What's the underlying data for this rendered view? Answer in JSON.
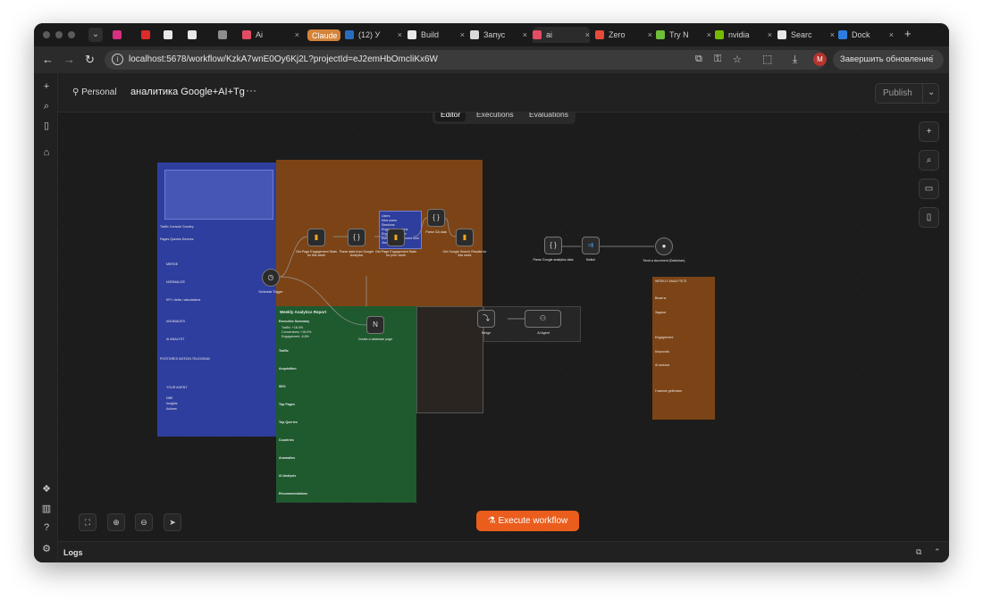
{
  "browser": {
    "tabs": [
      {
        "label": "",
        "color": "#d6307f"
      },
      {
        "label": "",
        "color": "#e12b2b"
      },
      {
        "label": "",
        "color": "#e8e8e8"
      },
      {
        "label": "",
        "color": "#e8e8e8"
      },
      {
        "label": "",
        "color": "#8d8d8d"
      },
      {
        "label": "Ai",
        "color": "#e24d64"
      },
      {
        "label": "Claude",
        "color": "#d4833a"
      },
      {
        "label": "(12) У",
        "color": "#2a6dc0"
      },
      {
        "label": "Build",
        "color": "#e8e8e8"
      },
      {
        "label": "Запус",
        "color": "#d9d9d9"
      },
      {
        "label": "ai",
        "color": "#e24d64"
      },
      {
        "label": "Zero",
        "color": "#e84a3a"
      },
      {
        "label": "Try N",
        "color": "#6fbf3a"
      },
      {
        "label": "nvidia",
        "color": "#76b900"
      },
      {
        "label": "Searc",
        "color": "#e8e8e8"
      },
      {
        "label": "Dock",
        "color": "#2b7ee0"
      }
    ],
    "url": "localhost:5678/workflow/KzkA7wnE0Oy6Kj2L?projectId=eJ2emHbOmcliKx6W",
    "avatar_letter": "M",
    "update_label": "Завершить обновление"
  },
  "header": {
    "project": "Personal",
    "title": "аналитика Google+AI+Tg",
    "publish_label": "Publish"
  },
  "modes": [
    "Editor",
    "Executions",
    "Evaluations"
  ],
  "canvas": {
    "nodes": [
      {
        "label": "Get Page Engagement Stats for this week"
      },
      {
        "label": "Parse data from Google Analytics"
      },
      {
        "label": "Get Page Engagement Stats for prior week"
      },
      {
        "label": "Parse GA data"
      },
      {
        "label": "Get Google Search Results for this week"
      },
      {
        "label": "Parse Google analytics data"
      },
      {
        "label": "Switch"
      },
      {
        "label": "Send a document (Darkchan)"
      },
      {
        "label": "Schedule Trigger"
      },
      {
        "label": "Create a database page"
      },
      {
        "label": "Merge"
      },
      {
        "label": "AI Agent"
      }
    ],
    "blue_sticky": {
      "lines": [
        "Traffic Console Country",
        "Pages Queries Devices",
        "MERGE",
        "NORMALIZE",
        "KPI / delta / calculations",
        "ANOMALIES",
        "AI ANALYST",
        "POSTGRES NOTION TELEGRAM",
        "YOUR AGENT",
        "DBE",
        "Insights",
        "Actions"
      ]
    },
    "green_sticky": {
      "title": "Weekly Analytics Report",
      "lines": [
        "Executive Summary",
        "Traffic: +18.4%",
        "Conversions +18.0%",
        "Engagement -6.8%",
        "Traffic",
        "Acquisition",
        "SEO",
        "Top Pages",
        "Top Queries",
        "Countries",
        "Anomalies",
        "AI Analysis",
        "Recommendations"
      ]
    },
    "orange2_sticky": {
      "lines": [
        "WEEKLY ANALYTICS",
        "Визиты",
        "Задачи",
        "Engagement",
        "Keywords",
        "AI анализ",
        "Главное действие"
      ]
    },
    "info_box": {
      "lines": [
        "Users",
        "New users",
        "Sessions",
        "Engaged sessions",
        "Engagement rate",
        "Average engagement time",
        "Views"
      ]
    }
  },
  "execute_label": "Execute workflow",
  "logs_label": "Logs"
}
